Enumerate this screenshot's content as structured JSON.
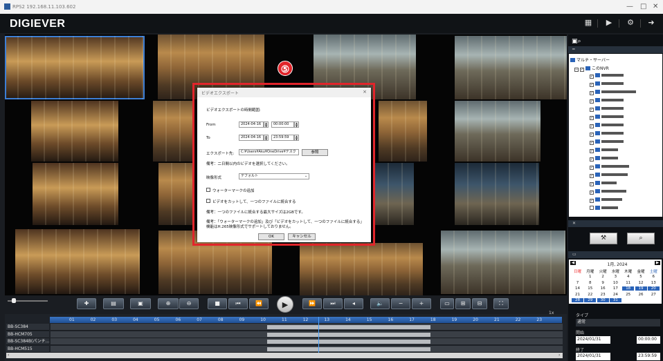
{
  "window": {
    "title": "RPS2 192.168.11.103.602",
    "min": "—",
    "max": "□",
    "close": "✕"
  },
  "app": {
    "logo": "DIGIEVER",
    "toolbar_icons": [
      "layout-icon",
      "play-icon",
      "settings-icon",
      "logout-icon"
    ]
  },
  "marker": {
    "number": "⑤"
  },
  "dialog": {
    "title": "ビデオエクスポート",
    "close": "×",
    "section": "ビデオエクスポートの時間範囲:",
    "from_label": "From",
    "from_date": "2024-04-16",
    "from_time": "00:00:00",
    "to_label": "To",
    "to_date": "2024-04-16",
    "to_time": "23:59:59",
    "export_label": "エクスポート先:",
    "export_path": "C:¥Users¥Aku¥OneDrive¥デスク",
    "browse": "参照",
    "note1": "備考：二日間以内のビデオを選択してください。",
    "format_label": "映像形式",
    "format_value": "デフォルト",
    "watermark": "ウォーターマークの追加",
    "merge": "ビデオをカットして、一つのファイルに統合する",
    "note2": "備考：一つのファイルに統合する最大サイズは2GBです。",
    "note3": "備考：「ウォーターマークの追加」及び「ビデオをカットして、一つのファイルに統合する」機能はH.265映像形式でサポートしておりません。",
    "ok": "OK",
    "cancel": "キャンセル"
  },
  "side": {
    "server": "マルチ・サーバー",
    "nvr": "このNVR"
  },
  "calendar": {
    "title": "1月, 2024",
    "days": [
      "日曜",
      "月曜",
      "火曜",
      "水曜",
      "木曜",
      "金曜",
      "土曜"
    ],
    "weeks": [
      [
        "",
        "1",
        "2",
        "3",
        "4",
        "5",
        "6"
      ],
      [
        "7",
        "8",
        "9",
        "10",
        "11",
        "12",
        "13"
      ],
      [
        "14",
        "15",
        "16",
        "17",
        "18",
        "19",
        "20"
      ],
      [
        "21",
        "22",
        "23",
        "24",
        "25",
        "26",
        "27"
      ],
      [
        "28",
        "29",
        "30",
        "31",
        "",
        "",
        ""
      ]
    ]
  },
  "search": {
    "type_label": "タイプ",
    "type_value": "通常",
    "start_label": "開始",
    "start_date": "2024/01/31",
    "start_time": "00:00:00",
    "end_label": "終了",
    "end_date": "2024/01/31",
    "end_time": "23:59:59"
  },
  "timeline": {
    "speed": "1x",
    "hours": [
      "01",
      "02",
      "03",
      "04",
      "05",
      "06",
      "07",
      "08",
      "09",
      "10",
      "11",
      "12",
      "13",
      "14",
      "15",
      "16",
      "17",
      "18",
      "19",
      "20",
      "21",
      "22",
      "23"
    ],
    "channels": [
      "BB-SC384",
      "BB-HCM705",
      "BB-SC384B(パンチ...",
      "BB-HCM515"
    ]
  }
}
